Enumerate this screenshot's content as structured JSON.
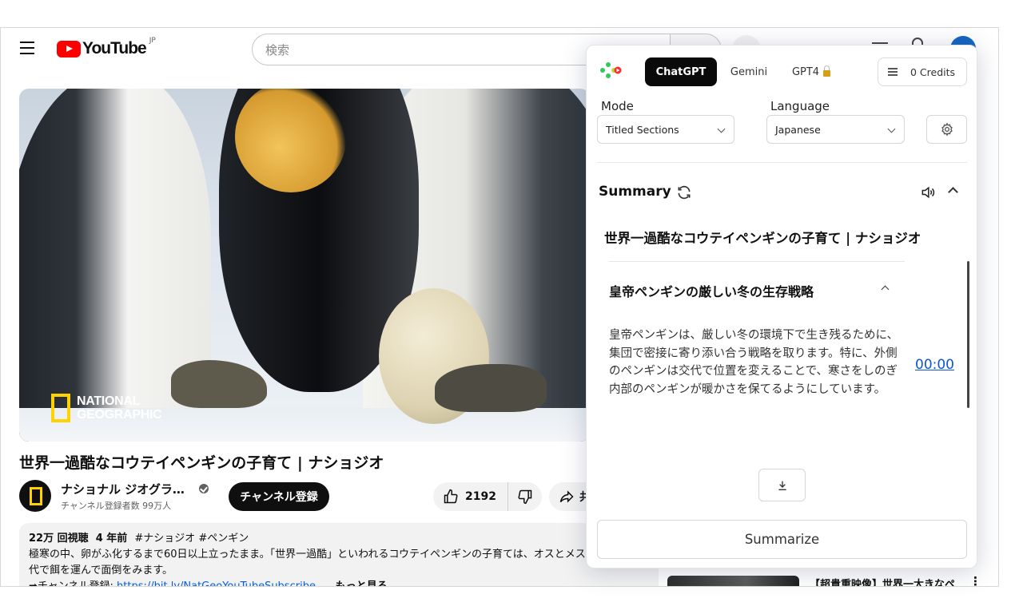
{
  "youtube": {
    "logo_text": "YouTube",
    "logo_region": "JP",
    "search_placeholder": "検索",
    "video_overlay": {
      "line1": "NATIONAL",
      "line2": "GEOGRAPHIC"
    },
    "video_title": "世界一過酷なコウテイペンギンの子育て | ナショジオ",
    "channel_name": "ナショナル ジオグラ…",
    "subscribers": "チャンネル登録者数 99万人",
    "subscribe_label": "チャンネル登録",
    "like_count": "2192",
    "share_label": "共",
    "description": {
      "views": "22万 回視聴",
      "age": "4 年前",
      "tags": "#ナショジオ #ペンギン",
      "line1": "極寒の中、卵がふ化するまで60日以上立ったまま。「世界一過酷」といわれるコウテイペンギンの子育ては、オスとメスが交",
      "line2": "代で餌を運んで面倒をみます。",
      "link_prefix": "➡チャンネル登録: ",
      "link": "https://bit.ly/NatGeoYouTubeSubscribe",
      "more": "...もっと見る"
    },
    "recommendation_title": "【超貴重映像】世界一大きなペ"
  },
  "extension": {
    "tabs": [
      {
        "label": "ChatGPT",
        "active": true
      },
      {
        "label": "Gemini",
        "active": false
      },
      {
        "label": "GPT4",
        "active": false
      }
    ],
    "credits_label": "0 Credits",
    "mode_label": "Mode",
    "mode_value": "Titled Sections",
    "language_label": "Language",
    "language_value": "Japanese",
    "summary_heading": "Summary",
    "doc_title": "世界一過酷なコウテイペンギンの子育て | ナショジオ",
    "section_title": "皇帝ペンギンの厳しい冬の生存戦略",
    "section_text": "皇帝ペンギンは、厳しい冬の環境下で生き残るために、集団で密接に寄り添い合う戦略を取ります。特に、外側のペンギンは交代で位置を変えることで、寒さをしのぎ内部のペンギンが暖かさを保てるようにしています。",
    "timestamp": "00:00",
    "summarize_label": "Summarize",
    "accent": "#0a0a0a",
    "link_color": "#0b57d0"
  }
}
